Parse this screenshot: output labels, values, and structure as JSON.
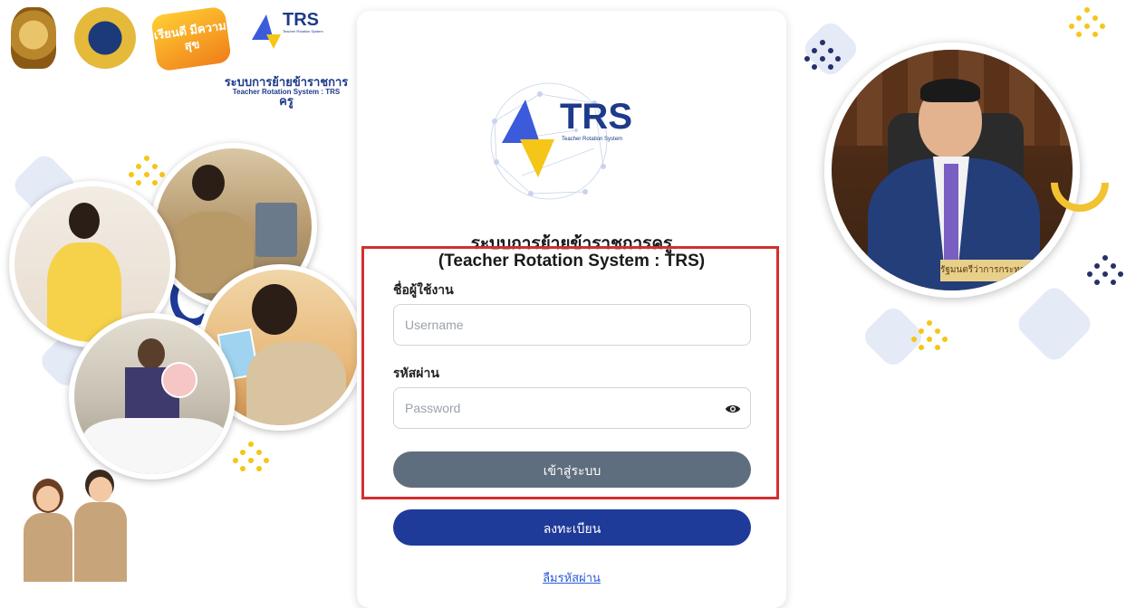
{
  "header": {
    "system_name_th": "ระบบการย้ายข้าราชการครู",
    "system_name_en": "Teacher Rotation System : TRS",
    "happy_logo_text": "เรียนดี มีความสุข",
    "trs_logo_text": "TRS",
    "trs_logo_sub": "Teacher Rotation System"
  },
  "card": {
    "title_th": "ระบบการย้ายข้าราชการครู",
    "title_en": "(Teacher Rotation System : TRS)",
    "username_label": "ชื่อผู้ใช้งาน",
    "username_placeholder": "Username",
    "username_value": "",
    "password_label": "รหัสผ่าน",
    "password_placeholder": "Password",
    "password_value": "",
    "login_label": "เข้าสู่ระบบ",
    "register_label": "ลงทะเบียน",
    "forgot_label": "ลืมรหัสผ่าน"
  },
  "portrait": {
    "nameplate": "รัฐมนตรีว่าการกระทรวงศึกษาธิการ"
  },
  "colors": {
    "accent_blue": "#1f3b99",
    "login_gray": "#5f6e7e",
    "highlight_red": "#d32f2f",
    "dot_yellow": "#f5c518",
    "dot_navy": "#26306b"
  },
  "icons": {
    "password_toggle": "eye-icon"
  }
}
